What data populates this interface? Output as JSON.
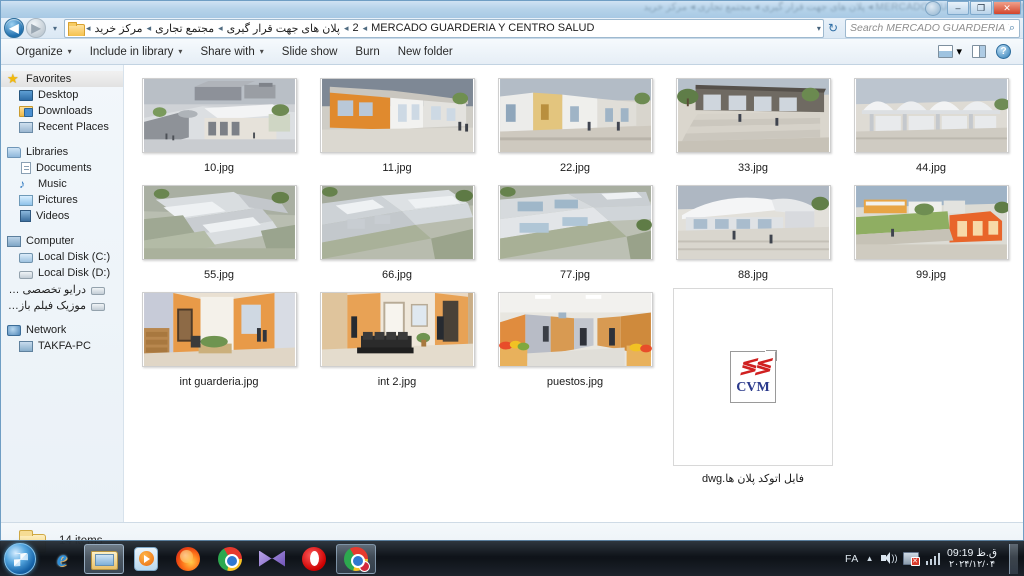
{
  "window": {
    "title_ghost": "MERCADO GUARDERIA Y CENTRO SALUD ◂ ۲ ◂ پلان های جهت قرار گیری ◂ مجتمع تجاری ◂ مرکز خرید",
    "minimize_label": "–",
    "maximize_label": "❐",
    "close_label": "✕"
  },
  "nav": {
    "back_label": "◀",
    "forward_label": "▶",
    "recent_label": "▾",
    "refresh_label": "↻",
    "dropdown_label": "▾",
    "breadcrumbs": [
      {
        "label": "مرکز خرید",
        "rtl": true
      },
      {
        "label": "مجتمع تجاری",
        "rtl": true
      },
      {
        "label": "پلان های جهت قرار گیری",
        "rtl": true
      },
      {
        "label": "2",
        "rtl": false
      },
      {
        "label": "MERCADO GUARDERIA Y CENTRO SALUD",
        "rtl": false
      }
    ],
    "separator": "◂"
  },
  "search": {
    "placeholder": "Search MERCADO GUARDERIA Y CEN...",
    "icon_label": "⌕"
  },
  "toolbar": {
    "items": [
      {
        "label": "Organize",
        "caret": true
      },
      {
        "label": "Include in library",
        "caret": true
      },
      {
        "label": "Share with",
        "caret": true
      },
      {
        "label": "Slide show",
        "caret": false
      },
      {
        "label": "Burn",
        "caret": false
      },
      {
        "label": "New folder",
        "caret": false
      }
    ],
    "view_caret": "▾",
    "help_label": "?"
  },
  "sidebar": {
    "groups": [
      {
        "header": {
          "label": "Favorites",
          "icon": "star-icon",
          "selected": true
        },
        "items": [
          {
            "label": "Desktop",
            "icon": "desktop-icon"
          },
          {
            "label": "Downloads",
            "icon": "downloads-folder-icon"
          },
          {
            "label": "Recent Places",
            "icon": "recent-places-icon"
          }
        ]
      },
      {
        "header": {
          "label": "Libraries",
          "icon": "libraries-icon",
          "selected": false
        },
        "items": [
          {
            "label": "Documents",
            "icon": "documents-icon"
          },
          {
            "label": "Music",
            "icon": "music-note-icon"
          },
          {
            "label": "Pictures",
            "icon": "pictures-icon"
          },
          {
            "label": "Videos",
            "icon": "videos-icon"
          }
        ]
      },
      {
        "header": {
          "label": "Computer",
          "icon": "computer-icon",
          "selected": false
        },
        "items": [
          {
            "label": "Local Disk (C:)",
            "icon": "system-disk-icon",
            "rtl": false
          },
          {
            "label": "Local Disk (D:)",
            "icon": "disk-icon",
            "rtl": false
          },
          {
            "label": "درایو تخصصی معماری",
            "icon": "disk-icon",
            "rtl": true
          },
          {
            "label": "موزیک فیلم بازی (:F)",
            "icon": "disk-icon",
            "rtl": true
          }
        ]
      },
      {
        "header": {
          "label": "Network",
          "icon": "network-icon",
          "selected": false
        },
        "items": [
          {
            "label": "TAKFA-PC",
            "icon": "computer-node-icon"
          }
        ]
      }
    ]
  },
  "files": [
    {
      "name": "10.jpg",
      "kind": "image",
      "rtl": false,
      "scene": "exterior-aerial-white-building"
    },
    {
      "name": "11.jpg",
      "kind": "image",
      "rtl": false,
      "scene": "exterior-orange-facade"
    },
    {
      "name": "22.jpg",
      "kind": "image",
      "rtl": false,
      "scene": "exterior-street-view"
    },
    {
      "name": "33.jpg",
      "kind": "image",
      "rtl": false,
      "scene": "exterior-plaza-steps"
    },
    {
      "name": "44.jpg",
      "kind": "image",
      "rtl": false,
      "scene": "exterior-vaulted-roof"
    },
    {
      "name": "55.jpg",
      "kind": "image",
      "rtl": false,
      "scene": "aerial-site-plan"
    },
    {
      "name": "66.jpg",
      "kind": "image",
      "rtl": false,
      "scene": "aerial-hillside-complex"
    },
    {
      "name": "77.jpg",
      "kind": "image",
      "rtl": false,
      "scene": "aerial-terraced-buildings"
    },
    {
      "name": "88.jpg",
      "kind": "image",
      "rtl": false,
      "scene": "exterior-curved-roof-plaza"
    },
    {
      "name": "99.jpg",
      "kind": "image",
      "rtl": false,
      "scene": "exterior-orange-block-landscape"
    },
    {
      "name": "int  guarderia.jpg",
      "kind": "image",
      "rtl": false,
      "scene": "interior-orange-corridor"
    },
    {
      "name": "int 2.jpg",
      "kind": "image",
      "rtl": false,
      "scene": "interior-waiting-room"
    },
    {
      "name": "puestos.jpg",
      "kind": "image",
      "rtl": false,
      "scene": "interior-market-stalls"
    },
    {
      "name": "فایل اتوکد پلان ها.dwg",
      "kind": "dwg",
      "rtl": true,
      "icon_text": "CVM"
    }
  ],
  "status": {
    "items_text": "14 items",
    "folder_icon": "folder-icon"
  },
  "taskbar": {
    "start_label": "start-orb",
    "buttons": [
      {
        "name": "internet-explorer",
        "glyph": "e",
        "active": false
      },
      {
        "name": "windows-explorer",
        "glyph": "",
        "active": true
      },
      {
        "name": "windows-media-player",
        "glyph": "",
        "active": false
      },
      {
        "name": "firefox",
        "glyph": "",
        "active": false
      },
      {
        "name": "google-chrome",
        "glyph": "",
        "active": false
      },
      {
        "name": "mail-client",
        "glyph": "",
        "active": false
      },
      {
        "name": "opera",
        "glyph": "",
        "active": false
      },
      {
        "name": "chrome-window",
        "glyph": "",
        "active": true
      }
    ],
    "tray": {
      "language": "FA",
      "caret": "▲",
      "clock_time": "09:19 ق.ظ",
      "clock_date": "۲۰۲۴/۱۲/۰۴",
      "network_badge": "✕"
    }
  },
  "colors": {
    "accent_blue": "#2f7cb5",
    "window_chrome": "#dbe8f4",
    "taskbar": "#131920",
    "folder_yellow": "#f0cc6e",
    "dwg_red": "#d02020",
    "dwg_blue": "#2b3a8c"
  }
}
